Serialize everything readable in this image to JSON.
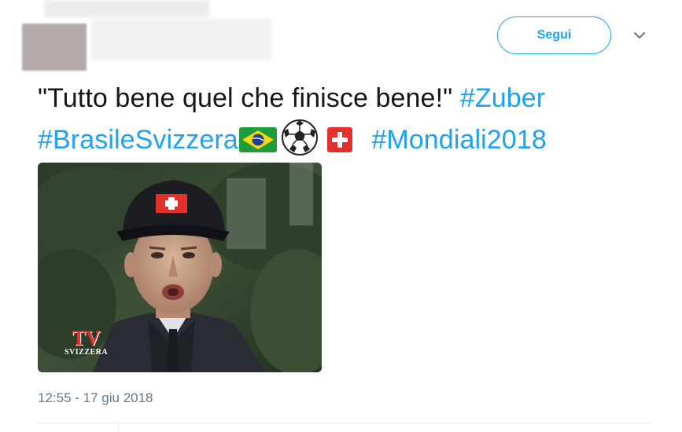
{
  "header": {
    "follow_label": "Segui",
    "menu_icon": "chevron-down-icon"
  },
  "tweet": {
    "text_quote": "\"Tutto bene quel che finisce bene!\"",
    "hashtag_1": "#Zuber",
    "hashtag_2": "#BrasileSvizzera",
    "hashtag_3": "#Mondiali2018",
    "emojis": [
      "brazil-flag",
      "soccer-ball",
      "swiss-flag"
    ]
  },
  "media": {
    "watermark_tv": "TV",
    "watermark_svizzera": "SVIZZERA"
  },
  "timestamp": "12:55 - 17 giu 2018",
  "colors": {
    "accent": "#1da1f2",
    "text": "#14171a",
    "muted": "#657786"
  }
}
